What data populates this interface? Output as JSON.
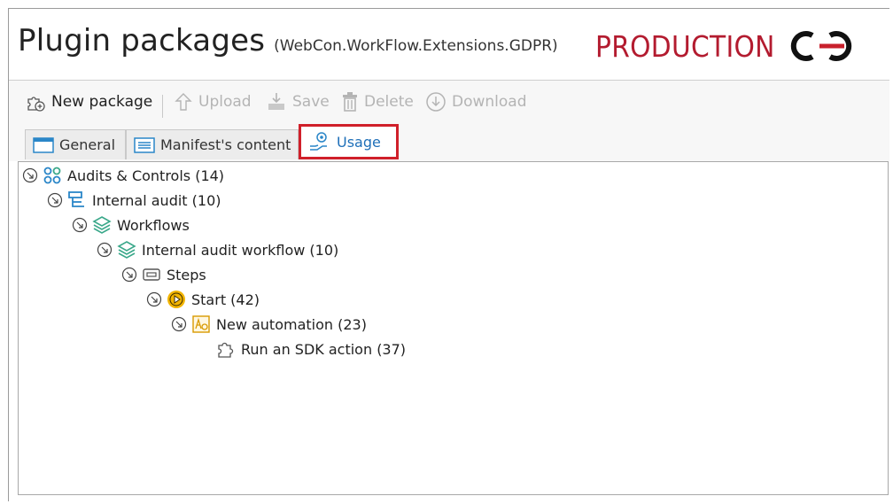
{
  "window": {
    "title": "Plugin packages",
    "subtitle": "(WebCon.WorkFlow.Extensions.GDPR)",
    "environment": "PRODUCTION",
    "environment_color": "#b31b2f"
  },
  "toolbar": {
    "new_package": "New package",
    "upload": "Upload",
    "save": "Save",
    "delete": "Delete",
    "download": "Download"
  },
  "tabs": [
    {
      "label": "General",
      "icon": "window-icon"
    },
    {
      "label": "Manifest's content",
      "icon": "list-icon"
    },
    {
      "label": "Usage",
      "icon": "gear-hand-icon",
      "active": true
    }
  ],
  "tree": [
    {
      "label": "Audits & Controls (14)",
      "icon": "app-icon",
      "level": 0
    },
    {
      "label": "Internal audit (10)",
      "icon": "process-icon",
      "level": 1
    },
    {
      "label": "Workflows",
      "icon": "layers-icon",
      "level": 2
    },
    {
      "label": "Internal audit workflow (10)",
      "icon": "layers-icon",
      "level": 3
    },
    {
      "label": "Steps",
      "icon": "steps-icon",
      "level": 4
    },
    {
      "label": "Start (42)",
      "icon": "start-step-icon",
      "level": 5
    },
    {
      "label": "New automation (23)",
      "icon": "automation-icon",
      "level": 6
    },
    {
      "label": "Run an SDK action (37)",
      "icon": "puzzle-icon",
      "level": 7
    }
  ],
  "colors": {
    "active_tab_highlight": "#d0202a",
    "active_tab_text": "#1e6fb8",
    "tree_icon_teal": "#3aa88a",
    "tree_icon_blue": "#2a86c8",
    "start_icon_yellow": "#f2b400"
  }
}
